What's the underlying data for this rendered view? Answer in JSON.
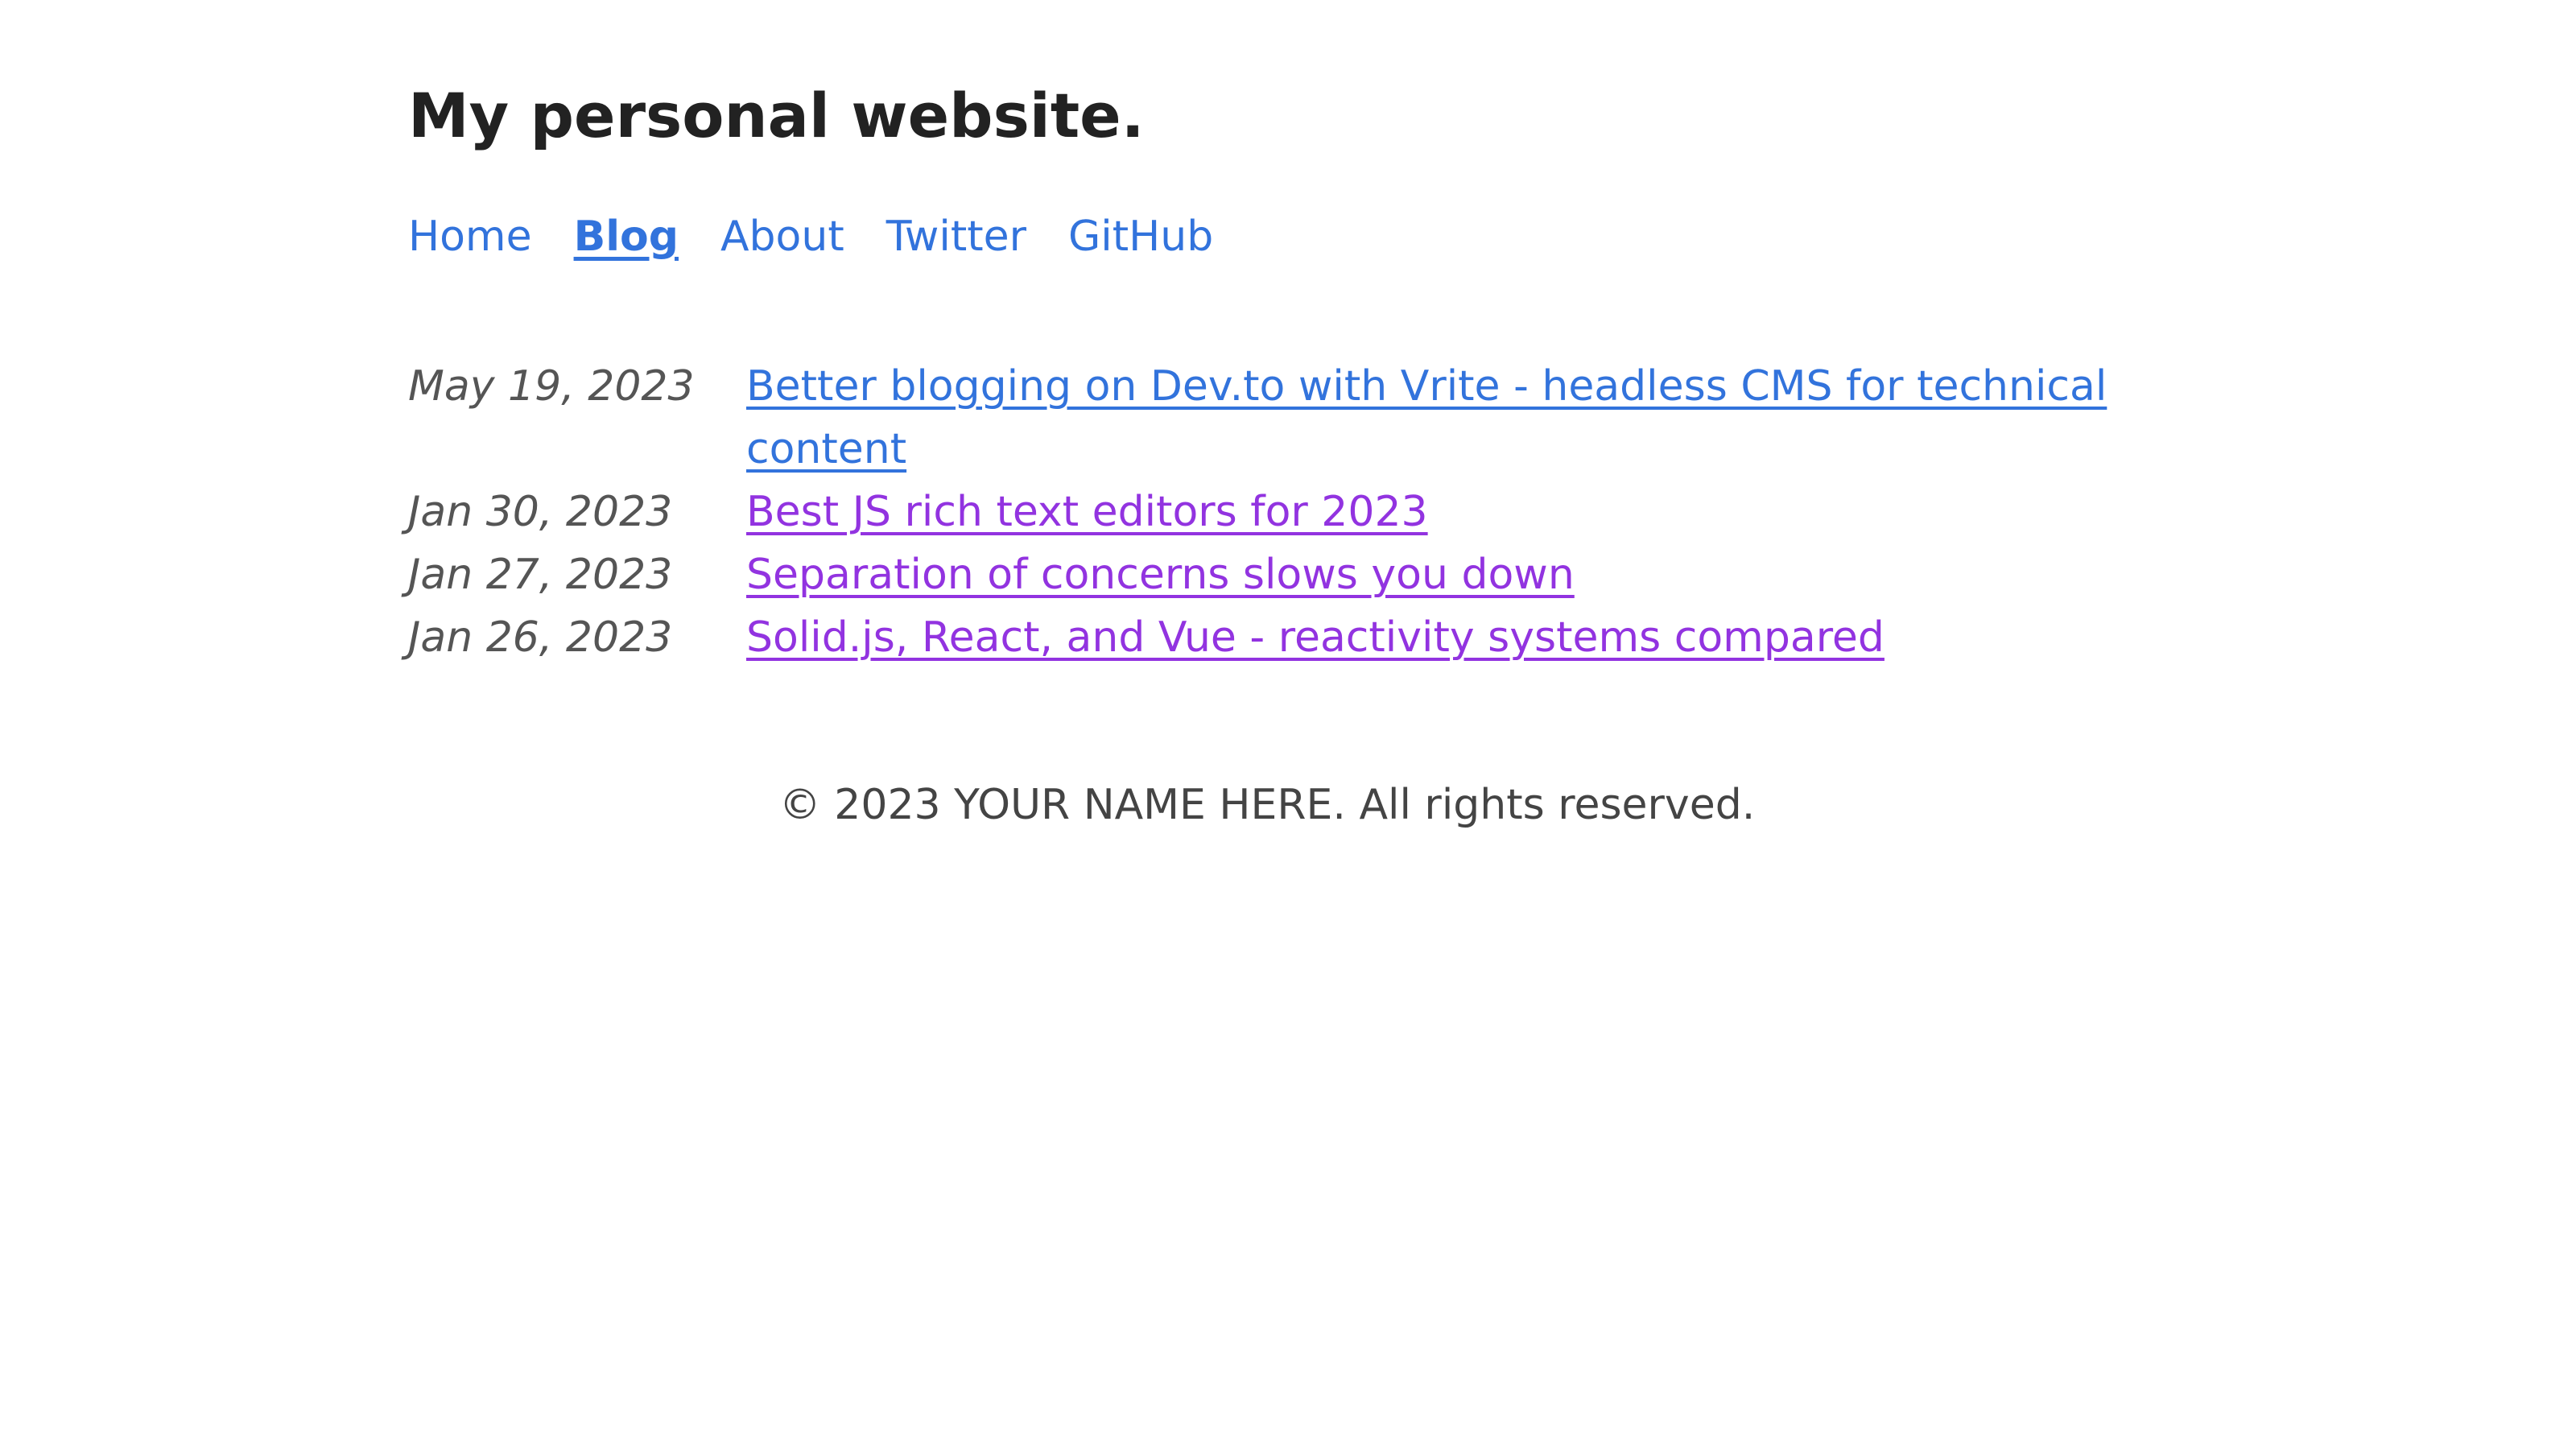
{
  "header": {
    "title": "My personal website."
  },
  "nav": {
    "items": [
      {
        "label": "Home",
        "active": false
      },
      {
        "label": "Blog",
        "active": true
      },
      {
        "label": "About",
        "active": false
      },
      {
        "label": "Twitter",
        "active": false
      },
      {
        "label": "GitHub",
        "active": false
      }
    ]
  },
  "posts": [
    {
      "date": "May 19, 2023",
      "title": "Better blogging on Dev.to with Vrite - headless CMS for technical content",
      "visited": false
    },
    {
      "date": "Jan 30, 2023",
      "title": "Best JS rich text editors for 2023",
      "visited": true
    },
    {
      "date": "Jan 27, 2023",
      "title": "Separation of concerns slows you down",
      "visited": true
    },
    {
      "date": "Jan 26, 2023",
      "title": "Solid.js, React, and Vue - reactivity systems compared",
      "visited": true
    }
  ],
  "footer": {
    "text": "© 2023 YOUR NAME HERE. All rights reserved."
  },
  "colors": {
    "link": "#3273dc",
    "visited_link": "#9233e0",
    "title": "#222222",
    "date": "#555555",
    "footer": "#444444"
  }
}
